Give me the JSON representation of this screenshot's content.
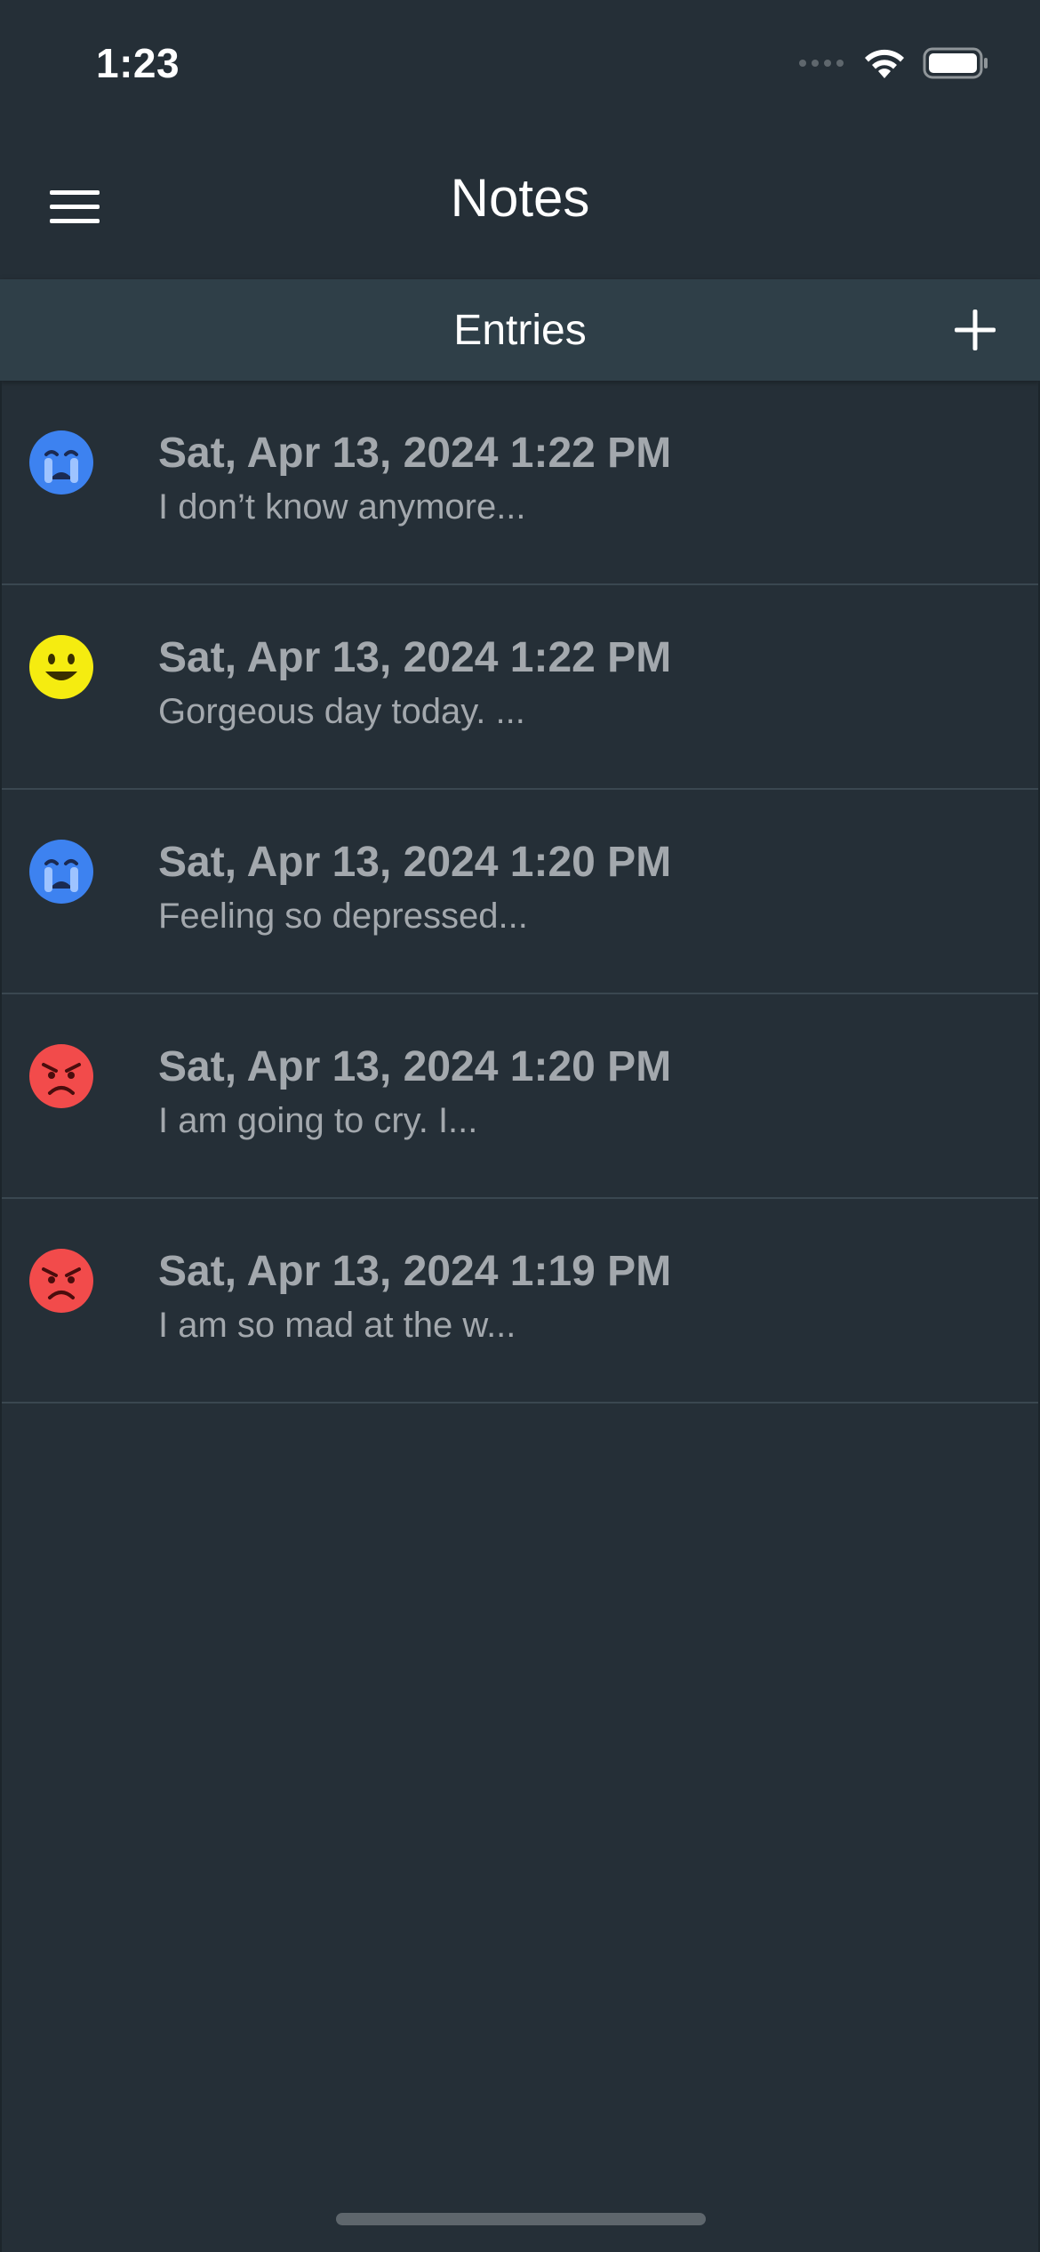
{
  "status_bar": {
    "time": "1:23"
  },
  "nav": {
    "title": "Notes",
    "menu_icon": "hamburger-menu-icon"
  },
  "section": {
    "title": "Entries",
    "add_icon": "plus-icon"
  },
  "entries": [
    {
      "date": "Sat, Apr 13, 2024 1:22 PM",
      "preview": "I don’t know anymore...",
      "mood": "crying",
      "mood_color": "#3d82f0"
    },
    {
      "date": "Sat, Apr 13, 2024 1:22 PM",
      "preview": "Gorgeous day today. ...",
      "mood": "happy",
      "mood_color": "#f5ec10"
    },
    {
      "date": "Sat, Apr 13, 2024 1:20 PM",
      "preview": "Feeling so depressed...",
      "mood": "crying",
      "mood_color": "#3d82f0"
    },
    {
      "date": "Sat, Apr 13, 2024 1:20 PM",
      "preview": "I am going to cry. I...",
      "mood": "angry",
      "mood_color": "#f24b4b"
    },
    {
      "date": "Sat, Apr 13, 2024 1:19 PM",
      "preview": "I am so mad at the w...",
      "mood": "angry",
      "mood_color": "#f24b4b"
    }
  ],
  "colors": {
    "background": "#252f37",
    "section_header": "#2f3f48",
    "text_muted": "#a3a8ad"
  }
}
